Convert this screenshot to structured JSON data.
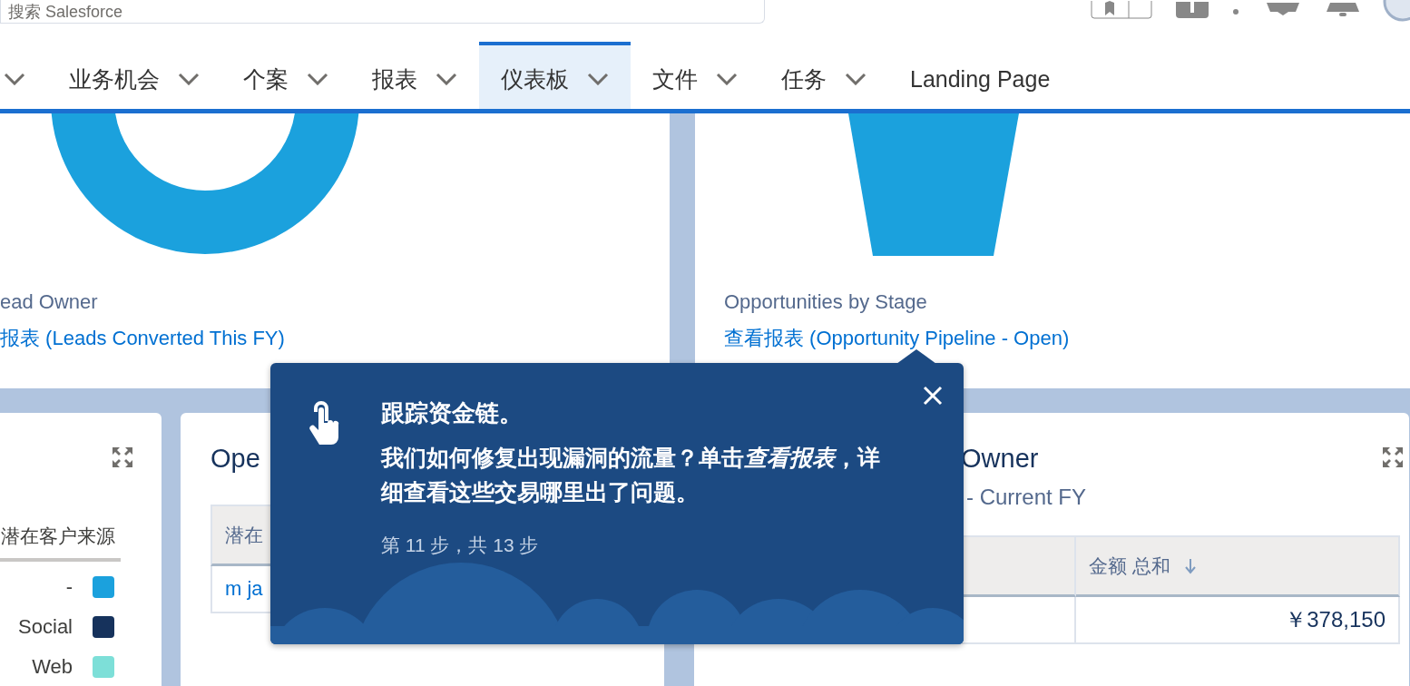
{
  "header": {
    "search": {
      "placeholder": "搜索 Salesforce"
    }
  },
  "tabs": [
    {
      "selected": false,
      "has_menu": true
    },
    {
      "label": "业务机会",
      "selected": false,
      "has_menu": true
    },
    {
      "label": "个案",
      "selected": false,
      "has_menu": true
    },
    {
      "label": "报表",
      "selected": false,
      "has_menu": true
    },
    {
      "label": "仪表板",
      "selected": true,
      "has_menu": true
    },
    {
      "label": "文件",
      "selected": false,
      "has_menu": true
    },
    {
      "label": "任务",
      "selected": false,
      "has_menu": true
    },
    {
      "label": "Landing Page",
      "selected": false,
      "has_menu": false
    }
  ],
  "top_cards": [
    {
      "kind": "donut",
      "caption": "ead Owner",
      "link": "报表 (Leads Converted This FY)"
    },
    {
      "kind": "funnel",
      "caption": "Opportunities by Stage",
      "link": "查看报表 (Opportunity Pipeline - Open)"
    }
  ],
  "legend_card": {
    "header": "潜在客户来源",
    "items": [
      {
        "label": "-",
        "color": "#1ba1dd"
      },
      {
        "label": "Social",
        "color": "#16325c"
      },
      {
        "label": "Web",
        "color": "#7ddfd8"
      }
    ]
  },
  "middle_card": {
    "title": "Ope",
    "column_1": "潜在",
    "row_1": "m ja"
  },
  "right_card": {
    "title": "Owner",
    "subtitle": "- Current FY",
    "columns": [
      "金额 总和"
    ],
    "sorted_descending": true,
    "value": "￥378,150"
  },
  "popover": {
    "title": "跟踪资金链。",
    "body": [
      {
        "text": "我们如何修复出现漏洞的流量？单击",
        "italic": false
      },
      {
        "text": "查看报表",
        "italic": true
      },
      {
        "text": "，详细查看这些交易哪里出了问题。",
        "italic": false
      }
    ],
    "step": "第 11 步，共 13 步"
  }
}
